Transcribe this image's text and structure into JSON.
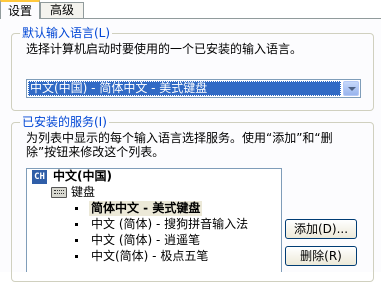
{
  "tabs": [
    {
      "label": "设置"
    },
    {
      "label": "高级"
    }
  ],
  "default_lang": {
    "title": "默认输入语言(L)",
    "description": "选择计算机启动时要使用的一个已安装的输入语言。",
    "selected": "中文(中国) - 简体中文 - 美式键盘"
  },
  "services": {
    "title": "已安装的服务(I)",
    "description_line1": "为列表中显示的每个输入语言选择服务。使用“添加”和“删",
    "description_line2": "除”按钮来修改这个列表。",
    "language_badge": "CH",
    "language": "中文(中国)",
    "category": "键盘",
    "items": [
      {
        "label": "简体中文 - 美式键盘"
      },
      {
        "label": "中文 (简体) - 搜狗拼音输入法"
      },
      {
        "label": "中文 (简体) - 逍遥笔"
      },
      {
        "label": "中文(简体) - 极点五笔"
      }
    ],
    "add_button": "添加(D)...",
    "remove_button": "删除(R)"
  },
  "colors": {
    "group_title": "#0046d5",
    "selection": "#316ac5",
    "tab_highlight": "#ffc83c"
  }
}
